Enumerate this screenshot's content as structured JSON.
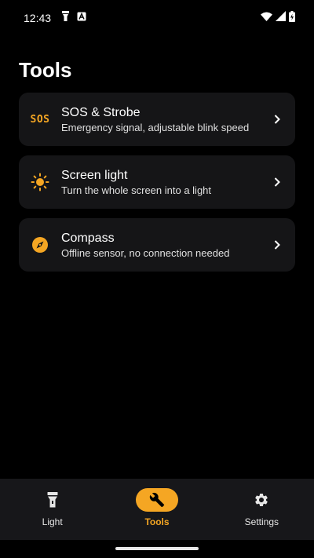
{
  "status_bar": {
    "time": "12:43",
    "left_icons": [
      "flashlight-icon",
      "notification-a-icon"
    ],
    "right_icons": [
      "wifi-icon",
      "cell-signal-icon",
      "battery-charging-icon"
    ]
  },
  "page": {
    "title": "Tools"
  },
  "tools": [
    {
      "icon": "sos-icon",
      "icon_text": "SOS",
      "title": "SOS & Strobe",
      "subtitle": "Emergency signal, adjustable blink speed"
    },
    {
      "icon": "sun-icon",
      "title": "Screen light",
      "subtitle": "Turn the whole screen into a light"
    },
    {
      "icon": "compass-icon",
      "title": "Compass",
      "subtitle": "Offline sensor, no connection needed"
    }
  ],
  "bottom_nav": {
    "items": [
      {
        "icon": "flashlight-icon",
        "label": "Light",
        "active": false
      },
      {
        "icon": "wrench-icon",
        "label": "Tools",
        "active": true
      },
      {
        "icon": "gear-icon",
        "label": "Settings",
        "active": false
      }
    ]
  },
  "colors": {
    "background": "#000000",
    "card": "#151517",
    "accent": "#f5a623",
    "nav_background": "#17171a"
  }
}
